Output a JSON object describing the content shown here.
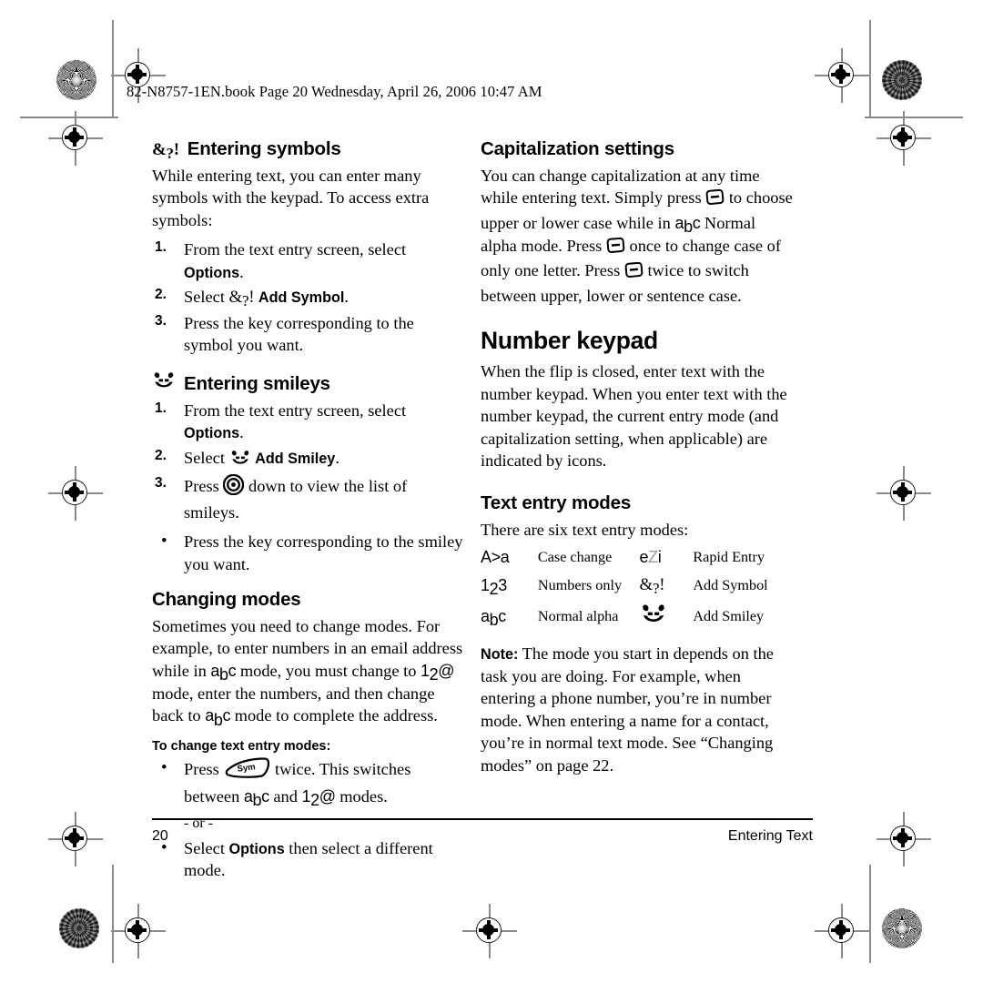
{
  "header": {
    "line": "82-N8757-1EN.book  Page 20  Wednesday, April 26, 2006  10:47 AM"
  },
  "left_column": {
    "entering_symbols": {
      "icon": "symbol-mode-icon",
      "heading": "Entering symbols",
      "intro": "While entering text, you can enter many symbols with the keypad. To access extra symbols:",
      "steps": [
        {
          "num": "1.",
          "pre": "From the text entry screen, select ",
          "ui": "Options",
          "post": "."
        },
        {
          "num": "2.",
          "pre": "Select ",
          "icon": "symbol-mode-icon",
          "ui": "Add Symbol",
          "post": "."
        },
        {
          "num": "3.",
          "pre": "Press the key corresponding to the symbol you want.",
          "ui": "",
          "post": ""
        }
      ]
    },
    "entering_smileys": {
      "icon": "smiley-mode-icon",
      "heading": "Entering smileys",
      "steps": [
        {
          "num": "1.",
          "pre": "From the text entry screen, select ",
          "ui": "Options",
          "post": "."
        },
        {
          "num": "2.",
          "pre": "Select ",
          "icon": "smiley-mode-icon",
          "ui": "Add Smiley",
          "post": "."
        },
        {
          "num": "3.",
          "pre": "Press ",
          "icon": "navigation-key-icon",
          "post": " down to view the list of smileys."
        }
      ],
      "bullet": "Press the key corresponding to the smiley you want."
    },
    "changing_modes": {
      "heading": "Changing modes",
      "para_1": "Sometimes you need to change modes. For example, to enter numbers in an email address while in ",
      "para_2": " mode, you must change to ",
      "para_3": " mode, enter the numbers, and then change back to ",
      "para_4": " mode to complete the address.",
      "subheading": "To change text entry modes:",
      "bullet_1_pre": "Press ",
      "bullet_1_mid": " twice. This switches between ",
      "bullet_1_and": " and ",
      "bullet_1_end": " modes.",
      "or_text": "- or -",
      "bullet_2_pre": "Select ",
      "bullet_2_ui": "Options",
      "bullet_2_post": " then select a different mode."
    }
  },
  "right_column": {
    "capitalization": {
      "heading": "Capitalization settings",
      "t1": "You can change capitalization at any time while entering text. Simply press ",
      "t2": " to choose upper or lower case while in ",
      "t3": " Normal alpha mode. Press ",
      "t4": " once to change case of only one letter. Press ",
      "t5": " twice to switch between upper, lower or sentence case."
    },
    "number_keypad": {
      "heading": "Number keypad",
      "para": "When the flip is closed, enter text with the number keypad. When you enter text with the number keypad, the current entry mode (and capitalization setting, when applicable) are indicated by icons."
    },
    "text_entry_modes": {
      "heading": "Text entry modes",
      "intro": "There are six text entry modes:",
      "rows": [
        {
          "icon_left": "case-change-icon",
          "label_left": "Case change",
          "icon_right": "rapid-entry-icon",
          "label_right": "Rapid Entry"
        },
        {
          "icon_left": "numbers-only-icon",
          "label_left": "Numbers only",
          "icon_right": "symbol-mode-icon",
          "label_right": "Add Symbol"
        },
        {
          "icon_left": "normal-alpha-icon",
          "label_left": "Normal alpha",
          "icon_right": "smiley-mode-icon",
          "label_right": "Add Smiley"
        }
      ]
    },
    "note": {
      "label": "Note:",
      "text": " The mode you start in depends on the task you are doing. For example, when entering a phone number, you’re in number mode. When entering a name for a contact, you’re in normal text mode. See “Changing modes” on page 22."
    }
  },
  "footer": {
    "page_number": "20",
    "section_title": "Entering Text"
  },
  "mode_glyphs": {
    "normal_alpha": {
      "a": "a",
      "b": "b",
      "c": "c"
    },
    "numbers_at": {
      "one": "1",
      "two": "2",
      "at": "@"
    },
    "numbers_only": {
      "one": "1",
      "two": "2",
      "three": "3"
    },
    "case_change": "A>a",
    "rapid_entry": {
      "e": "e",
      "z": "Z",
      "i": "i"
    },
    "symbol": {
      "amp": "&",
      "q": "?",
      "bang": "!"
    },
    "sym_key_label": "Sym"
  },
  "colors": {
    "ink": "#000000",
    "gray_rule": "#8a8a8a",
    "gray_glyph": "#9a9a9a"
  }
}
